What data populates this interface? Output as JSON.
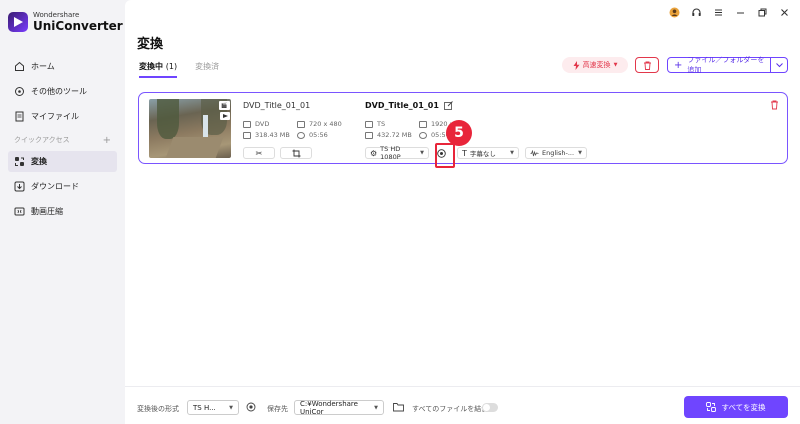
{
  "app": {
    "logo_small": "Wondershare",
    "logo_big": "UniConverter"
  },
  "sidebar": {
    "items_top": [
      {
        "label": "ホーム",
        "icon": "home-icon"
      },
      {
        "label": "その他のツール",
        "icon": "tools-icon"
      },
      {
        "label": "マイファイル",
        "icon": "file-icon"
      }
    ],
    "quick_access_label": "クイックアクセス",
    "quick_access_add": "+",
    "items_quick": [
      {
        "label": "変換",
        "icon": "convert-icon",
        "active": true
      },
      {
        "label": "ダウンロード",
        "icon": "download-icon"
      },
      {
        "label": "動画圧縮",
        "icon": "compress-icon"
      }
    ]
  },
  "main": {
    "title": "変換",
    "tabs": [
      {
        "label": "変換中",
        "count": "(1)",
        "active": true
      },
      {
        "label": "変換済",
        "count": "",
        "active": false
      }
    ],
    "fast_convert_label": "高速変換",
    "add_files_label": "ファイル／フォルダーを追加"
  },
  "item": {
    "source": {
      "name": "DVD_Title_01_01",
      "format": "DVD",
      "resolution": "720 x 480",
      "size": "318.43 MB",
      "duration": "05:56"
    },
    "output": {
      "name": "DVD_Title_01_01",
      "format": "TS",
      "resolution": "1920 x",
      "size": "432.72 MB",
      "duration": "05:56"
    },
    "options": {
      "preset": "TS HD 1080P",
      "subtitle": "字幕なし",
      "audio": "English-..."
    },
    "step_number": "5"
  },
  "footer": {
    "format_label": "変換後の形式",
    "format_value": "TS H...",
    "save_label": "保存先",
    "save_path": "C:¥Wondershare UniCor",
    "merge_label": "すべてのファイルを結合",
    "convert_all_label": "すべてを変換"
  },
  "colors": {
    "accent": "#6f45ff",
    "danger": "#e2374b"
  }
}
